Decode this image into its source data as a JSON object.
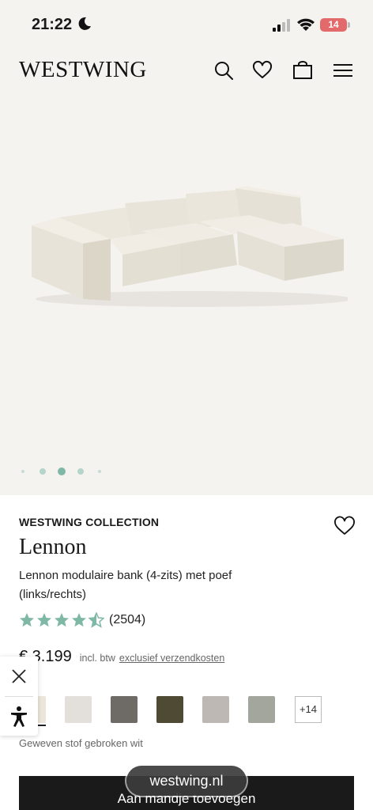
{
  "status_bar": {
    "time": "21:22",
    "battery": "14"
  },
  "header": {
    "logo": "WESTWING"
  },
  "carousel": {
    "dot_count": 5,
    "active_index": 2
  },
  "product": {
    "brand": "WESTWING COLLECTION",
    "name": "Lennon",
    "description": "Lennon modulaire bank (4-zits) met poef (links/rechts)",
    "rating_value": 4.5,
    "rating_count": "(2504)",
    "price": "€ 3.199",
    "vat_note": "incl. btw",
    "shipping_link": "exclusief verzendkosten"
  },
  "swatches": {
    "colors": [
      "#ece6da",
      "#e3e0dc",
      "#6e6a66",
      "#4f4a34",
      "#bdb8b4",
      "#a3a69d"
    ],
    "more_label": "+14",
    "selected_name": "Geweven stof gebroken wit"
  },
  "browser": {
    "url": "westwing.nl"
  },
  "cart": {
    "label": "Aan mandje toevoegen"
  },
  "colors": {
    "accent_green": "#7fb8a6",
    "button_dark": "#1a1a1a"
  }
}
